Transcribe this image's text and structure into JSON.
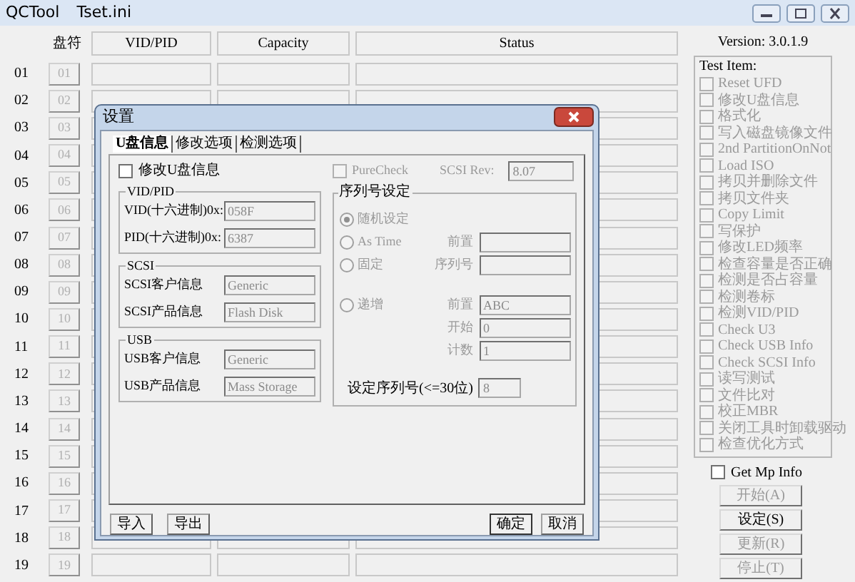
{
  "window": {
    "title": "QCTool",
    "file": "Tset.ini"
  },
  "grid": {
    "corner": "盘符",
    "columns": [
      "VID/PID",
      "Capacity",
      "Status"
    ],
    "rows": [
      {
        "number": "01",
        "port": "01",
        "disabled": true
      },
      {
        "number": "02",
        "port": "02",
        "disabled": true
      },
      {
        "number": "03",
        "port": "03",
        "disabled": true
      },
      {
        "number": "04",
        "port": "04",
        "disabled": true
      },
      {
        "number": "05",
        "port": "05",
        "disabled": true
      },
      {
        "number": "06",
        "port": "06",
        "disabled": true
      },
      {
        "number": "07",
        "port": "07",
        "disabled": true
      },
      {
        "number": "08",
        "port": "08",
        "disabled": true
      },
      {
        "number": "09",
        "port": "09",
        "disabled": true
      },
      {
        "number": "10",
        "port": "10",
        "disabled": true
      },
      {
        "number": "11",
        "port": "11",
        "disabled": true
      },
      {
        "number": "12",
        "port": "12",
        "disabled": true
      },
      {
        "number": "13",
        "port": "13",
        "disabled": true
      },
      {
        "number": "14",
        "port": "14",
        "disabled": true
      },
      {
        "number": "15",
        "port": "15",
        "disabled": true
      },
      {
        "number": "16",
        "port": "16",
        "disabled": true
      },
      {
        "number": "17",
        "port": "17",
        "disabled": true
      },
      {
        "number": "18",
        "port": "18",
        "disabled": true
      },
      {
        "number": "19",
        "port": "19",
        "disabled": true
      }
    ]
  },
  "side": {
    "version": "Version: 3.0.1.9",
    "group": "Test Item:",
    "items": [
      {
        "label": "Reset UFD",
        "checked": false,
        "disabled": true
      },
      {
        "label": "修改U盘信息",
        "checked": false,
        "disabled": true
      },
      {
        "label": "格式化",
        "checked": false,
        "disabled": true
      },
      {
        "label": "写入磁盘镜像文件",
        "checked": false,
        "disabled": true
      },
      {
        "label": "2nd PartitionOnNot",
        "checked": false,
        "disabled": true
      },
      {
        "label": "Load ISO",
        "checked": false,
        "disabled": true
      },
      {
        "label": "拷贝并删除文件",
        "checked": false,
        "disabled": true
      },
      {
        "label": "拷贝文件夹",
        "checked": false,
        "disabled": true
      },
      {
        "label": "Copy Limit",
        "checked": false,
        "disabled": true
      },
      {
        "label": "写保护",
        "checked": false,
        "disabled": true
      },
      {
        "label": "修改LED频率",
        "checked": false,
        "disabled": true
      },
      {
        "label": "检查容量是否正确",
        "checked": false,
        "disabled": true
      },
      {
        "label": "检测是否占容量",
        "checked": false,
        "disabled": true
      },
      {
        "label": "检测卷标",
        "checked": false,
        "disabled": true
      },
      {
        "label": "检测VID/PID",
        "checked": false,
        "disabled": true
      },
      {
        "label": "Check U3",
        "checked": false,
        "disabled": true
      },
      {
        "label": "Check USB Info",
        "checked": false,
        "disabled": true
      },
      {
        "label": "Check SCSI Info",
        "checked": false,
        "disabled": true
      },
      {
        "label": "读写测试",
        "checked": false,
        "disabled": true
      },
      {
        "label": "文件比对",
        "checked": false,
        "disabled": true
      },
      {
        "label": "校正MBR",
        "checked": false,
        "disabled": true
      },
      {
        "label": "关闭工具时卸载驱动",
        "checked": false,
        "disabled": true
      },
      {
        "label": "检查优化方式",
        "checked": false,
        "disabled": true
      }
    ],
    "mp_info": {
      "label": "Get Mp Info",
      "checked": false
    },
    "buttons": [
      {
        "label": "开始(A)",
        "disabled": true
      },
      {
        "label": "设定(S)",
        "disabled": false
      },
      {
        "label": "更新(R)",
        "disabled": true
      },
      {
        "label": "停止(T)",
        "disabled": true
      }
    ]
  },
  "dialog": {
    "title": "设置",
    "tabs": [
      {
        "label": "U盘信息",
        "selected": true
      },
      {
        "label": "修改选项",
        "selected": false
      },
      {
        "label": "检测选项",
        "selected": false
      }
    ],
    "modify": {
      "label": "修改U盘信息",
      "checked": false
    },
    "groups": [
      {
        "title": "VID/PID",
        "disabled": true,
        "fields": [
          {
            "label": "VID(十六进制)0x:",
            "value": "058F"
          },
          {
            "label": "PID(十六进制)0x:",
            "value": "6387"
          }
        ]
      },
      {
        "title": "SCSI",
        "disabled": true,
        "fields": [
          {
            "label": "SCSI客户信息",
            "value": "Generic"
          },
          {
            "label": "SCSI产品信息",
            "value": "Flash Disk"
          }
        ]
      },
      {
        "title": "USB",
        "disabled": true,
        "fields": [
          {
            "label": "USB客户信息",
            "value": "Generic"
          },
          {
            "label": "USB产品信息",
            "value": "Mass Storage"
          }
        ]
      }
    ],
    "purecheck": {
      "label": "PureCheck",
      "checked": false,
      "disabled": true
    },
    "scsi_rev": {
      "label": "SCSI Rev:",
      "value": "8.07"
    },
    "serial": {
      "title": "序列号设定",
      "options": [
        {
          "label": "随机设定",
          "selected": true,
          "disabled": true
        },
        {
          "label": "As Time",
          "selected": false,
          "disabled": true,
          "fields": [
            {
              "label": "前置"
            }
          ]
        },
        {
          "label": "固定",
          "selected": false,
          "disabled": true,
          "fields": [
            {
              "label": "序列号"
            }
          ]
        },
        {
          "label": "递增",
          "selected": false,
          "disabled": true,
          "fields": [
            {
              "label": "前置",
              "value": "ABC"
            },
            {
              "label": "开始",
              "value": "0"
            },
            {
              "label": "计数",
              "value": "1"
            }
          ]
        }
      ]
    },
    "serial_length": {
      "label": "设定序列号(<=30位)",
      "value": "8",
      "disabled": true
    },
    "buttons_left": [
      {
        "label": "导入",
        "default": false
      },
      {
        "label": "导出",
        "default": false
      }
    ],
    "buttons_right": [
      {
        "label": "确定",
        "default": true
      },
      {
        "label": "取消",
        "default": false
      }
    ]
  }
}
